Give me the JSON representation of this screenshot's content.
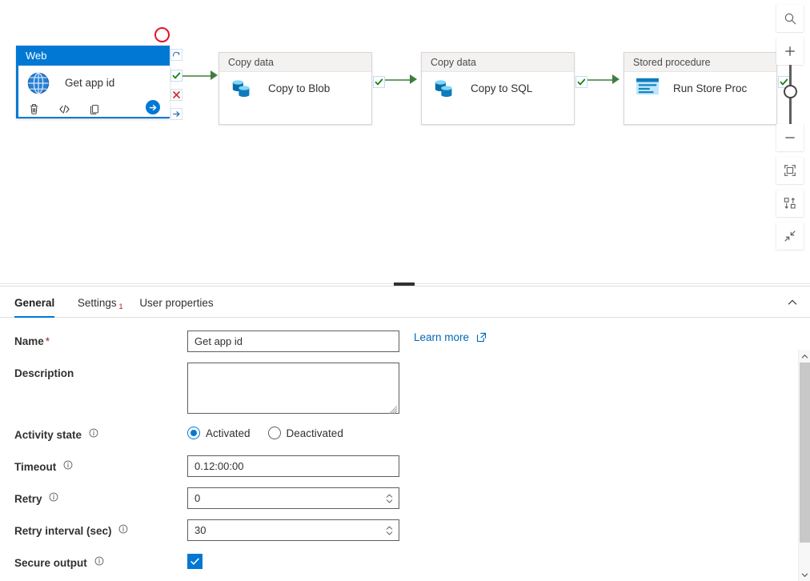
{
  "canvas": {
    "activities": [
      {
        "id": "web-activity",
        "type_label": "Web",
        "name": "Get app id",
        "icon": "globe-icon",
        "selected": true
      },
      {
        "id": "copy-to-blob-activity",
        "type_label": "Copy data",
        "name": "Copy to Blob",
        "icon": "copy-data-icon",
        "selected": false
      },
      {
        "id": "copy-to-sql-activity",
        "type_label": "Copy data",
        "name": "Copy to SQL",
        "icon": "copy-data-icon",
        "selected": false
      },
      {
        "id": "run-store-proc-activity",
        "type_label": "Stored procedure",
        "name": "Run Store Proc",
        "icon": "stored-procedure-icon",
        "selected": false
      }
    ],
    "card_toolbar": {
      "delete_label": "Delete",
      "code_label": "Code",
      "clone_label": "Clone",
      "go_label": "Open"
    },
    "anchors": {
      "skip_label": "Skip",
      "success_label": "Success",
      "failure_label": "Failure",
      "completion_label": "Completion"
    },
    "annotation": {
      "shape": "circle",
      "color": "#e81123"
    },
    "toolbar": {
      "buttons": [
        {
          "name": "zoom-search-button",
          "icon": "magnifier-icon"
        },
        {
          "name": "zoom-in-button",
          "icon": "plus-icon",
          "label": "+"
        },
        {
          "name": "zoom-slider",
          "icon": "slider-icon"
        },
        {
          "name": "zoom-out-button",
          "icon": "minus-icon",
          "label": "−"
        },
        {
          "name": "fit-to-screen-button",
          "icon": "fit-screen-icon"
        },
        {
          "name": "auto-align-button",
          "icon": "auto-align-icon"
        },
        {
          "name": "collapse-canvas-button",
          "icon": "collapse-diagonal-icon"
        }
      ]
    }
  },
  "panel": {
    "tabs": [
      {
        "label": "General",
        "active": true,
        "badge": ""
      },
      {
        "label": "Settings",
        "active": false,
        "badge": "1"
      },
      {
        "label": "User properties",
        "active": false,
        "badge": ""
      }
    ],
    "collapse_icon": "chevron-up-icon",
    "fields": {
      "name": {
        "label": "Name",
        "required_marker": "*",
        "value": "Get app id",
        "placeholder": ""
      },
      "learn_more": {
        "label": "Learn more",
        "icon": "external-link-icon"
      },
      "description": {
        "label": "Description",
        "value": "",
        "placeholder": ""
      },
      "activity_state": {
        "label": "Activity state",
        "info_icon": "info-icon",
        "options": [
          {
            "label": "Activated",
            "selected": true
          },
          {
            "label": "Deactivated",
            "selected": false
          }
        ]
      },
      "timeout": {
        "label": "Timeout",
        "info_icon": "info-icon",
        "value": "0.12:00:00"
      },
      "retry": {
        "label": "Retry",
        "info_icon": "info-icon",
        "value": "0"
      },
      "retry_interval": {
        "label": "Retry interval (sec)",
        "info_icon": "info-icon",
        "value": "30"
      },
      "secure_output": {
        "label": "Secure output",
        "info_icon": "info-icon",
        "checked": true
      }
    }
  },
  "colors": {
    "accent": "#0078d4",
    "required": "#a4262c",
    "badge": "#c50f1f",
    "connector": "#6d9e6d",
    "annotation": "#e81123"
  }
}
